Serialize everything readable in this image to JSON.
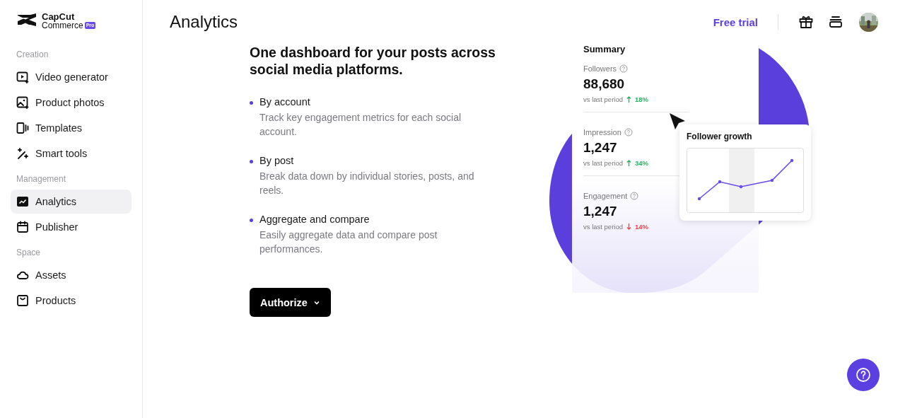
{
  "logo": {
    "line1": "CapCut",
    "line2": "Commerce",
    "badge": "Pro"
  },
  "sidebar": {
    "sections": [
      {
        "title": "Creation",
        "items": [
          {
            "kind": "video",
            "label": "Video generator",
            "selected": false
          },
          {
            "kind": "photo",
            "label": "Product photos",
            "selected": false
          },
          {
            "kind": "template",
            "label": "Templates",
            "selected": false
          },
          {
            "kind": "wand",
            "label": "Smart tools",
            "selected": false
          }
        ]
      },
      {
        "title": "Management",
        "items": [
          {
            "kind": "analytics",
            "label": "Analytics",
            "selected": true
          },
          {
            "kind": "calendar",
            "label": "Publisher",
            "selected": false
          }
        ]
      },
      {
        "title": "Space",
        "items": [
          {
            "kind": "cloud",
            "label": "Assets",
            "selected": false
          },
          {
            "kind": "box",
            "label": "Products",
            "selected": false
          }
        ]
      }
    ]
  },
  "header": {
    "title": "Analytics",
    "free_trial": "Free trial"
  },
  "intro": {
    "headline": "One dashboard for your posts across social media platforms.",
    "features": [
      {
        "title": "By account",
        "text": "Track key engagement metrics for each social account."
      },
      {
        "title": "By post",
        "text": "Break data down by individual stories, posts, and reels."
      },
      {
        "title": "Aggregate and compare",
        "text": "Easily aggregate data and compare post performances."
      }
    ],
    "button": "Authorize"
  },
  "summary": {
    "title": "Summary",
    "metrics": [
      {
        "label": "Followers",
        "value": "88,680",
        "compare": "vs last period",
        "change": "18%",
        "kind": "up"
      },
      {
        "label": "Impression",
        "value": "1,247",
        "compare": "vs last period",
        "change": "34%",
        "kind": "up"
      },
      {
        "label": "Engagement",
        "value": "1,247",
        "compare": "vs last period",
        "change": "14%",
        "kind": "down"
      }
    ],
    "popup_title": "Follower growth"
  }
}
